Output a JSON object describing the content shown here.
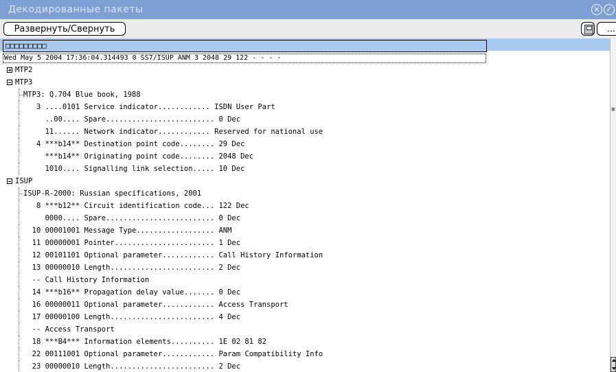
{
  "window": {
    "title": "Декодированные пакеты",
    "close_icon": "close-icon",
    "ok_icon": "ok-icon"
  },
  "toolbar": {
    "expand_collapse_label": "Развернуть/Свернуть",
    "save_icon": "save-icon",
    "more_label": "..."
  },
  "tab": {
    "label": "□□□□□□□□□"
  },
  "summary": "Wed May 5 2004 17:36:04.314493 0 SS7/ISUP ANM 3 2048 29 122 - - - -",
  "tree": {
    "rows": [
      {
        "level": 0,
        "toggle": "plus",
        "text": "MTP2"
      },
      {
        "level": 0,
        "toggle": "minus",
        "text": "MTP3"
      },
      {
        "level": 1,
        "toggle": "",
        "text": "MTP3: Q.704 Blue book, 1988"
      },
      {
        "level": 2,
        "toggle": "",
        "text": "   3 ....0101 Service indicator............ ISDN User Part"
      },
      {
        "level": 2,
        "toggle": "",
        "text": "     ..00.... Spare......................... 0 Dec"
      },
      {
        "level": 2,
        "toggle": "",
        "text": "     11...... Network indicator............ Reserved for national use"
      },
      {
        "level": 2,
        "toggle": "",
        "text": "   4 ***b14** Destination point code........ 29 Dec"
      },
      {
        "level": 2,
        "toggle": "",
        "text": "     ***b14** Originating point code........ 2048 Dec"
      },
      {
        "level": 2,
        "toggle": "",
        "text": "     1010.... Signalling link selection..... 10 Dec"
      },
      {
        "level": 0,
        "toggle": "minus",
        "text": "ISUP"
      },
      {
        "level": 1,
        "toggle": "",
        "text": "ISUP-R-2000: Russian specifications, 2001"
      },
      {
        "level": 2,
        "toggle": "",
        "text": "   8 ***b12** Circuit identification code... 122 Dec"
      },
      {
        "level": 2,
        "toggle": "",
        "text": "     0000.... Spare......................... 0 Dec"
      },
      {
        "level": 2,
        "toggle": "",
        "text": "  10 00001001 Message Type.................. ANM"
      },
      {
        "level": 2,
        "toggle": "",
        "text": "  11 00000001 Pointer....................... 1 Dec"
      },
      {
        "level": 2,
        "toggle": "",
        "text": "  12 00101101 Optional parameter............ Call History Information"
      },
      {
        "level": 2,
        "toggle": "",
        "text": "  13 00000010 Length........................ 2 Dec"
      },
      {
        "level": 2,
        "toggle": "",
        "text": "  -- Call History Information"
      },
      {
        "level": 2,
        "toggle": "",
        "text": "  14 ***b16** Propagation delay value....... 0 Dec"
      },
      {
        "level": 2,
        "toggle": "",
        "text": "  16 00000011 Optional parameter............ Access Transport"
      },
      {
        "level": 2,
        "toggle": "",
        "text": "  17 00000100 Length........................ 4 Dec"
      },
      {
        "level": 2,
        "toggle": "",
        "text": "  -- Access Transport"
      },
      {
        "level": 2,
        "toggle": "",
        "text": "  18 ***B4*** Information elements.......... 1E 02 81 82"
      },
      {
        "level": 2,
        "toggle": "",
        "text": "  22 00111001 Optional parameter............ Param Compatibility Info"
      },
      {
        "level": 2,
        "toggle": "",
        "text": "  23 00000010 Length........................ 2 Dec"
      }
    ]
  },
  "scrollbar": {
    "grip_label": "≡"
  }
}
